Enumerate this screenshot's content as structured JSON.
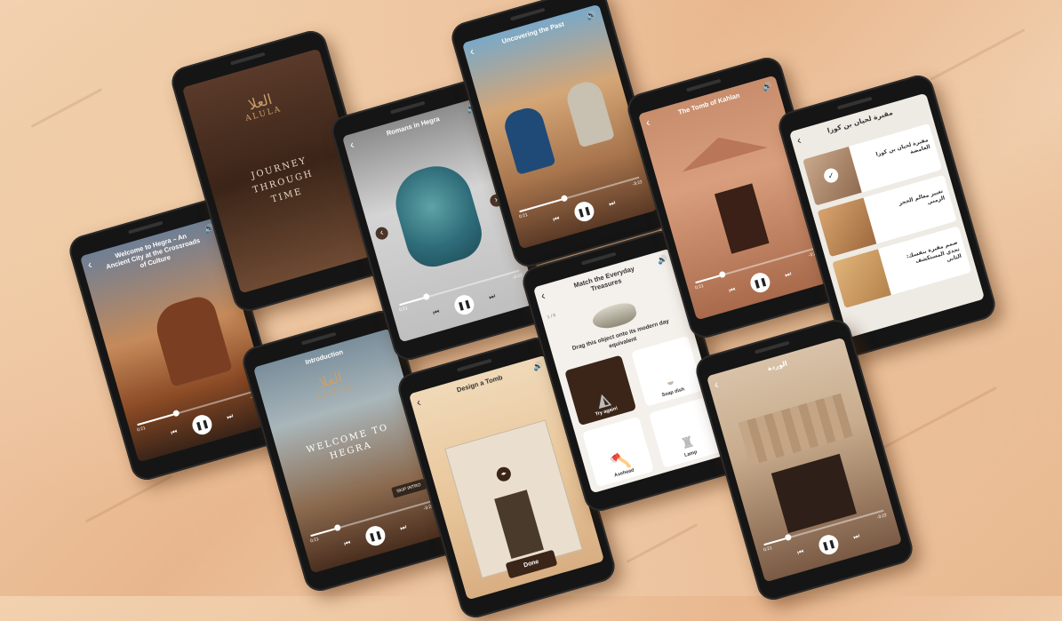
{
  "colors": {
    "sand": "#eabb92",
    "phone": "#151515",
    "brown": "#3b2518",
    "gold": "#c9a06a"
  },
  "icons": {
    "back": "‹",
    "volume": "🔊",
    "play_pause": "❚❚",
    "prev": "⏮",
    "next": "⏭",
    "check": "✓",
    "left": "‹",
    "right": "›",
    "swap": "◂▸"
  },
  "phones": {
    "welcome": {
      "title": "Welcome to Hegra – An Ancient City at the Crossroads of Culture",
      "time_start": "0:21",
      "time_end": "-3:22",
      "progress": 0.3
    },
    "journey": {
      "logo_ar": "العلا",
      "logo_en": "ALULA",
      "headline": "JOURNEY THROUGH TIME"
    },
    "intro": {
      "title": "Introduction",
      "logo_ar": "العلا",
      "logo_en": "ALULA",
      "headline": "WELCOME TO HEGRA",
      "skip_label": "SKIP INTRO",
      "time_start": "0:21",
      "time_end": "-3:22",
      "progress": 0.2
    },
    "romans": {
      "title": "Romans in Hegra",
      "time_start": "0:21",
      "time_end": "-3:22",
      "progress": 0.2
    },
    "design": {
      "title": "Design a Tomb",
      "done_label": "Done"
    },
    "uncovering": {
      "title": "Uncovering the Past",
      "time_start": "0:21",
      "time_end": "-3:22",
      "progress": 0.35
    },
    "match": {
      "title": "Match the Everyday Treasures",
      "counter": "1 / 6",
      "instruction": "Drag this object onto its modern day equivalent",
      "options": [
        "Try again!",
        "Soap dish",
        "Axehead",
        "Lamp"
      ]
    },
    "kahlan": {
      "title": "The Tomb of Kahlan",
      "time_start": "0:21",
      "time_end": "-3:22",
      "progress": 0.2
    },
    "wardah": {
      "title": "الوردة",
      "time_start": "0:21",
      "time_end": "-3:22",
      "progress": 0.18
    },
    "arabic_list": {
      "title": "مقبرة لحيان بن كوزا",
      "items": [
        "مقبرة لحيان بن كوزا الغامضة",
        "تغيير معالم الحجر الزمني",
        "صمم مقبرة بنفسك: تحدي المستكشف الثاني"
      ]
    }
  }
}
